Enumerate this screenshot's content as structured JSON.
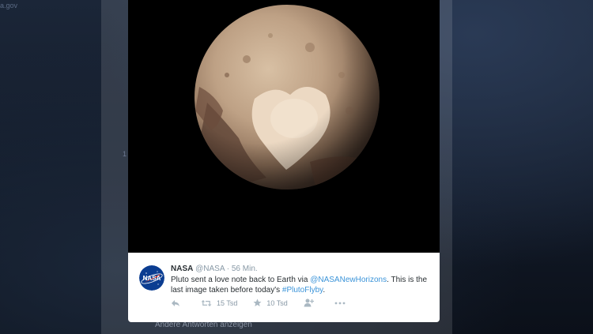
{
  "background": {
    "top_left_text": "a.gov",
    "left_col_text": "1",
    "bottom_text": "Andere Antworten anzeigen"
  },
  "tweet": {
    "author_name": "NASA",
    "handle": "@NASA",
    "separator": "·",
    "time": "56 Min.",
    "text_before": "Pluto sent a love note back to Earth via ",
    "mention": "@NASANewHorizons",
    "text_middle": ". This is the last image taken before today's ",
    "hashtag": "#PlutoFlyby",
    "text_after": ".",
    "retweets": "15 Tsd",
    "favorites": "10 Tsd",
    "avatar_label": "NASA"
  },
  "colors": {
    "link": "#3b94d9",
    "meta": "#8899a6",
    "nasa_blue": "#0b3d91",
    "nasa_red": "#fc3d21"
  },
  "icons": {
    "reply": "reply-icon",
    "retweet": "retweet-icon",
    "favorite": "star-icon",
    "follow": "follow-icon",
    "more": "more-icon"
  }
}
